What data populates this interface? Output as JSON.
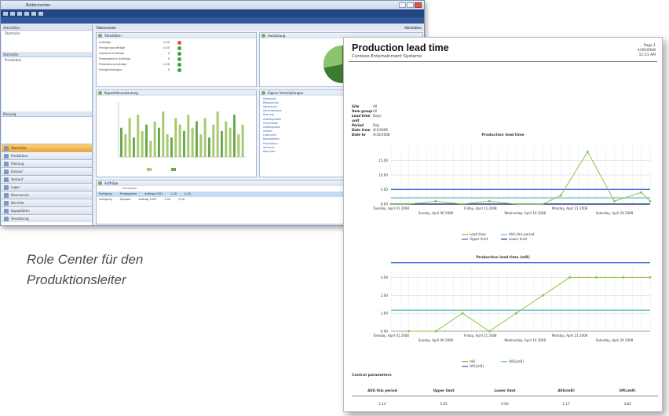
{
  "caption": [
    "Role Center für den",
    "Produktionsleiter"
  ],
  "role_center": {
    "title": "Rollencenter",
    "activities_title": "Aktivitäten",
    "chart_title": "Auslastung",
    "capacity_title": "Kapazitätsauslastung",
    "links_title": "Eigene Verknüpfungen",
    "list_title": "Aufträge",
    "activities": [
      {
        "label": "Aufträge",
        "value": "0,00",
        "status": "red"
      },
      {
        "label": "Fertigungsaufträge",
        "value": "0,00",
        "status": "green"
      },
      {
        "label": "Geplante Aufträge",
        "value": "0",
        "status": "green"
      },
      {
        "label": "Freigegebene Aufträge",
        "value": "0",
        "status": "green"
      },
      {
        "label": "Produktionsaufträge",
        "value": "0,00",
        "status": "green"
      },
      {
        "label": "Fertigmeldungen",
        "value": "0",
        "status": "green"
      }
    ],
    "links": [
      "Übersicht",
      "Ressourcen",
      "Verbrauch",
      "Istmeldungen",
      "Planung",
      "Arbeitsplätze",
      "Stücklisten",
      "Arbeitspläne",
      "Artikel",
      "Lagerorte",
      "Kapazitäten",
      "Produktion",
      "Versand",
      "Kalender"
    ],
    "nav_top": "Aktivitäten",
    "nav_pane_header": "Startseite",
    "nav_items": [
      "Startseite",
      "Produktion",
      "Planung",
      "Einkauf",
      "Verkauf",
      "Lager",
      "Ressourcen",
      "Berichte",
      "Kapazitäten",
      "Verwaltung"
    ],
    "rows": [
      {
        "a": "Fertigung",
        "b": "Freigegeben",
        "c": "Auftrag 1001",
        "d": "1,00",
        "e": "0,00"
      },
      {
        "a": "Fertigung",
        "b": "Geplant",
        "c": "Auftrag 1002",
        "d": "2,00",
        "e": "0,00"
      }
    ],
    "bars": [
      9,
      7,
      12,
      6,
      13,
      8,
      10,
      5,
      11,
      9,
      14,
      7,
      6,
      12,
      10,
      8,
      13,
      9,
      11,
      7,
      12,
      6,
      10,
      14,
      8,
      11,
      9,
      13,
      7,
      10
    ],
    "pie": [
      0.72,
      0.18,
      0.1
    ],
    "colors": {
      "accent": "#21457e",
      "bar": "#a7c96f",
      "pie_main": "#3d7a34",
      "pie_alt": "#8cc46b"
    }
  },
  "report": {
    "title": "Production lead time",
    "company": "Contoso Entertainment Systems",
    "page_info": [
      "Page 1",
      "4/30/2008",
      "11:51 AM"
    ],
    "filters": [
      {
        "k": "Site",
        "v": "All"
      },
      {
        "k": "Item group",
        "v": "All"
      },
      {
        "k": "Lead time unit",
        "v": "Days"
      },
      {
        "k": "Period",
        "v": "Day"
      },
      {
        "k": "Date from",
        "v": "4/1/2008"
      },
      {
        "k": "Date to",
        "v": "4/30/2008"
      }
    ],
    "chart1_title": "Production lead time",
    "chart2_title": "Production lead time (mR)",
    "stats_title": "Control parameters",
    "stats_headers": [
      "AVG this period",
      "Upper limit",
      "Lower limit",
      "AVG(mR)",
      "UPL(mR)"
    ],
    "stats_values": [
      "2.14",
      "5.05",
      "0.00",
      "1.17",
      "3.82"
    ]
  },
  "chart_data": [
    {
      "type": "line",
      "title": "Production lead time",
      "x": [
        "Tuesday, April 01 2008",
        "Sunday, April 06 2008",
        "Friday, April 11 2008",
        "Wednesday, April 16 2008",
        "Monday, April 21 2008",
        "Saturday, April 26 2008"
      ],
      "x_days": [
        1,
        30
      ],
      "ylim": [
        0,
        20
      ],
      "yticks": [
        "0.00",
        "5.00",
        "10.00",
        "15.00"
      ],
      "series": [
        {
          "name": "Lead time",
          "color": "#8bc34a",
          "points": [
            [
              1,
              0
            ],
            [
              3,
              0
            ],
            [
              6,
              1
            ],
            [
              9,
              0
            ],
            [
              12,
              1
            ],
            [
              15,
              0
            ],
            [
              18,
              0
            ],
            [
              20,
              3
            ],
            [
              23,
              18
            ],
            [
              26,
              1
            ],
            [
              29,
              4
            ],
            [
              30,
              1
            ]
          ]
        },
        {
          "name": "AVG this period",
          "color": "#6cc3c9",
          "value": 2.14
        },
        {
          "name": "Upper limit",
          "color": "#4169e1",
          "value": 5.05
        },
        {
          "name": "Lower limit",
          "color": "#2e3a8c",
          "value": 0
        }
      ],
      "legend": "bottom"
    },
    {
      "type": "line",
      "title": "Production lead time (mR)",
      "x": [
        "Tuesday, April 01 2008",
        "Sunday, April 06 2008",
        "Friday, April 11 2008",
        "Wednesday, April 16 2008",
        "Monday, April 21 2008",
        "Saturday, April 26 2008"
      ],
      "x_days": [
        1,
        30
      ],
      "ylim": [
        0,
        3.5
      ],
      "yticks": [
        "0.00",
        "1.00",
        "2.00",
        "3.00"
      ],
      "series": [
        {
          "name": "mR",
          "color": "#8bc34a",
          "points": [
            [
              3,
              0
            ],
            [
              6,
              0
            ],
            [
              9,
              1
            ],
            [
              12,
              0
            ],
            [
              15,
              1
            ],
            [
              18,
              2
            ],
            [
              21,
              3
            ],
            [
              24,
              3
            ],
            [
              27,
              3
            ],
            [
              30,
              3
            ]
          ]
        },
        {
          "name": "AVG(mR)",
          "color": "#6cc3c9",
          "value": 1.17
        },
        {
          "name": "UPL(mR)",
          "color": "#4169e1",
          "value": 3.82
        }
      ],
      "legend": "bottom"
    }
  ]
}
